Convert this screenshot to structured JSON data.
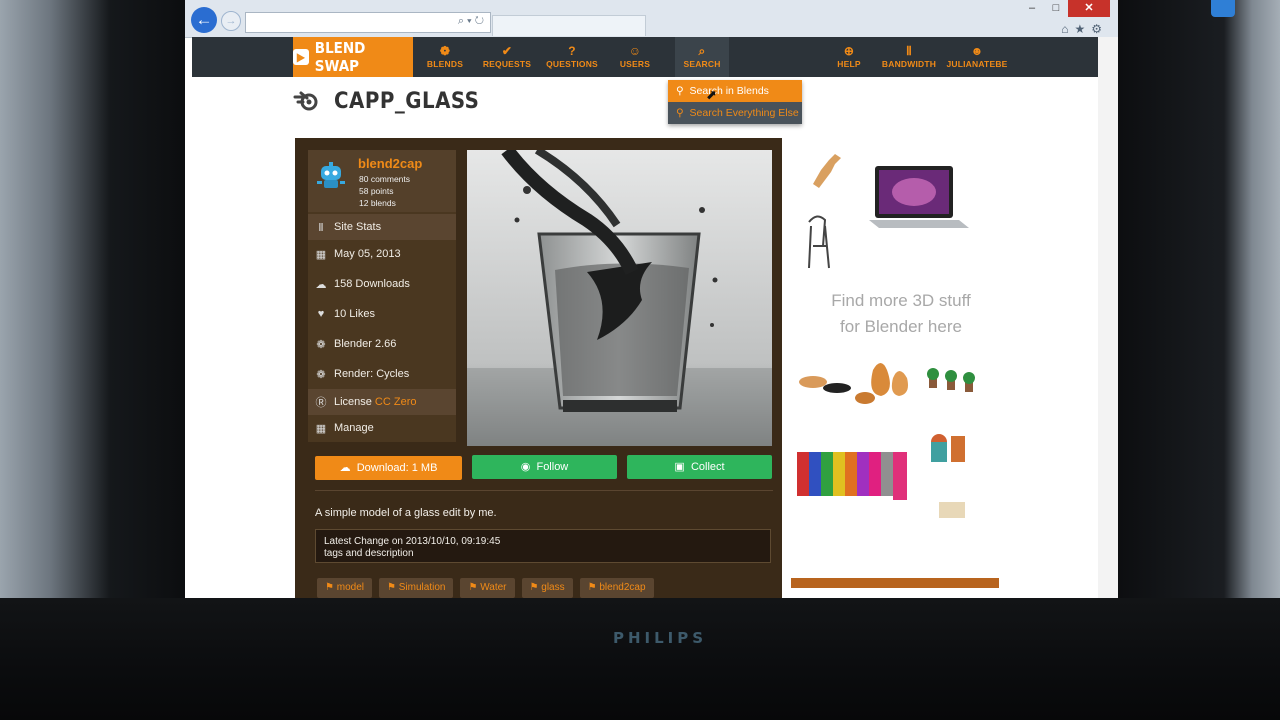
{
  "browser": {
    "back_icon": "back-arrow-icon",
    "forward_icon": "forward-arrow-icon",
    "address_icons": "⌕ ▾ ↻",
    "controls": {
      "minimize": "–",
      "maximize": "□",
      "close": "✕"
    },
    "toolbar_icons": "⌂★⚙"
  },
  "nav": {
    "logo": "BLEND SWAP",
    "items": [
      {
        "label": "BLENDS",
        "icon": "❁"
      },
      {
        "label": "REQUESTS",
        "icon": "✔"
      },
      {
        "label": "QUESTIONS",
        "icon": "?"
      },
      {
        "label": "USERS",
        "icon": "☺"
      },
      {
        "label": "SEARCH",
        "icon": "⌕"
      },
      {
        "label": "HELP",
        "icon": "⊕"
      },
      {
        "label": "BANDWIDTH",
        "icon": "Ⅱ"
      },
      {
        "label": "JULIANATEBE",
        "icon": "☻"
      }
    ],
    "search_menu": [
      "Search in Blends",
      "Search Everything Else"
    ]
  },
  "page": {
    "title": "CAPP_GLASS",
    "user": {
      "name": "blend2cap",
      "comments": "80 comments",
      "points": "58 points",
      "blends": "12 blends"
    },
    "stats": [
      {
        "icon": "Ⅱ",
        "label": "Site Stats"
      },
      {
        "icon": "▦",
        "label": "May 05, 2013"
      },
      {
        "icon": "☁",
        "label": "158 Downloads"
      },
      {
        "icon": "♥",
        "label": "10 Likes"
      },
      {
        "icon": "❁",
        "label": "Blender 2.66"
      },
      {
        "icon": "❁",
        "label": "Render: Cycles"
      }
    ],
    "license": {
      "label": "License",
      "value": "CC Zero"
    },
    "manage": "Manage",
    "buttons": {
      "download": "Download: 1 MB",
      "follow": "Follow",
      "collect": "Collect"
    },
    "description": "A simple model of a glass edit by me.",
    "latest_change": "Latest Change on 2013/10/10, 09:19:45",
    "change_note": "tags and description",
    "tags": [
      "model",
      "Simulation",
      "Water",
      "glass",
      "blend2cap"
    ]
  },
  "ad": {
    "line1": "Find more 3D stuff",
    "line2": "for Blender here"
  },
  "monitor": {
    "brand": "PHILIPS"
  },
  "colors": {
    "accent": "#f08a17",
    "green": "#2eb55c",
    "panel": "#3a2a18",
    "nav": "#2c3339"
  }
}
